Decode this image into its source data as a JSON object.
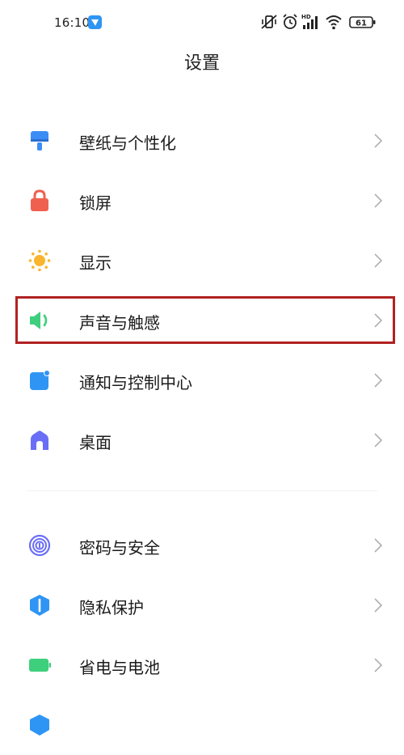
{
  "status_bar": {
    "time": "16:10",
    "hd_label": "HD",
    "battery_level": "61"
  },
  "header": {
    "title": "设置"
  },
  "groups": [
    {
      "items": [
        {
          "label": "壁纸与个性化",
          "icon": "wallpaper-brush-icon",
          "color": "#3b8df5"
        },
        {
          "label": "锁屏",
          "icon": "lock-icon",
          "color": "#f0604f"
        },
        {
          "label": "显示",
          "icon": "sun-icon",
          "color": "#f9b52d"
        },
        {
          "label": "声音与触感",
          "icon": "speaker-icon",
          "color": "#3ecf7c",
          "highlighted": true
        },
        {
          "label": "通知与控制中心",
          "icon": "notification-icon",
          "color": "#2f95f5"
        },
        {
          "label": "桌面",
          "icon": "home-icon",
          "color": "#6a6ef6"
        }
      ]
    },
    {
      "items": [
        {
          "label": "密码与安全",
          "icon": "fingerprint-icon",
          "color": "#6a6ef6"
        },
        {
          "label": "隐私保护",
          "icon": "privacy-shield-icon",
          "color": "#2f95f5"
        },
        {
          "label": "省电与电池",
          "icon": "battery-icon",
          "color": "#3ecf7c"
        }
      ]
    }
  ],
  "highlight_color": "#b22222"
}
